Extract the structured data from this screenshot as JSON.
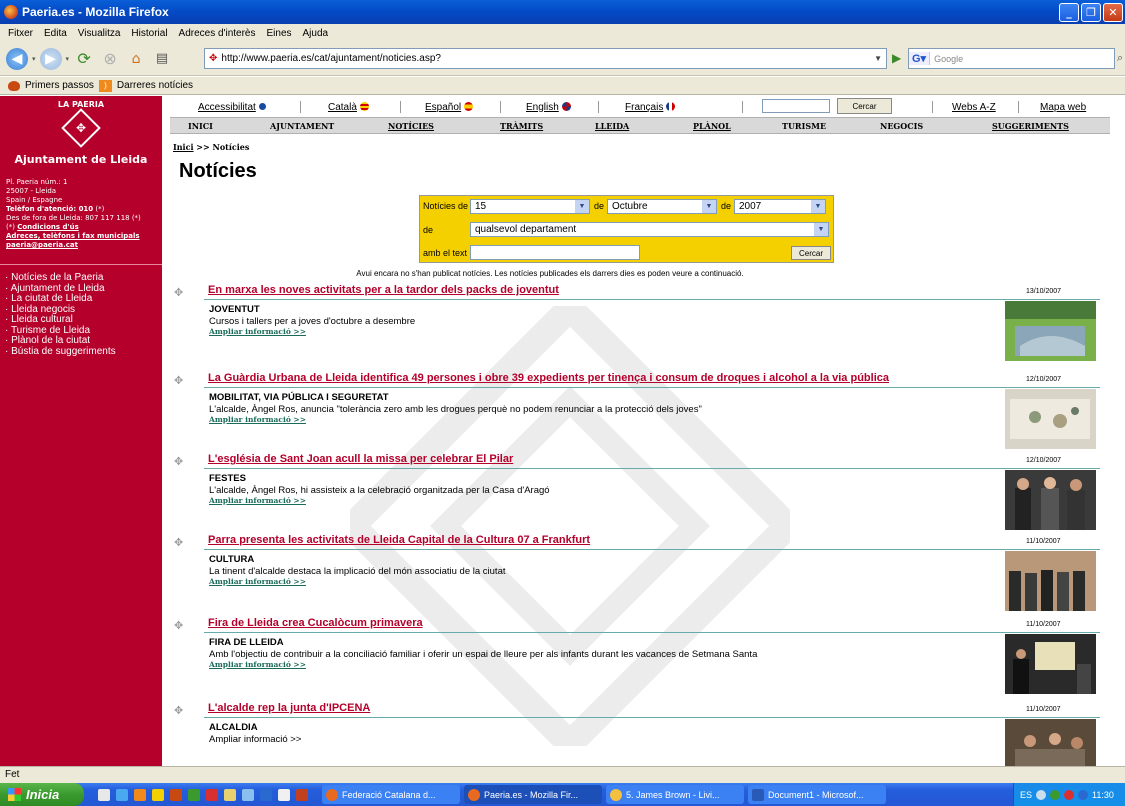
{
  "window": {
    "title": "Paeria.es - Mozilla Firefox"
  },
  "menubar": [
    "Fitxer",
    "Edita",
    "Visualitza",
    "Historial",
    "Adreces d'interès",
    "Eines",
    "Ajuda"
  ],
  "nav": {
    "url": "http://www.paeria.es/cat/ajuntament/noticies.asp?",
    "search_placeholder": "Google"
  },
  "bookmarks": [
    "Primers passos",
    "Darreres notícies"
  ],
  "sidebar": {
    "brand": "LA PAERIA",
    "org": "Ajuntament de Lleida",
    "address": [
      "Pl. Paeria núm.: 1",
      "25007 - Lleida",
      "Spain / Espagne"
    ],
    "phone_label": "Telèfon d'atenció: 010",
    "phone_suffix": "(*)",
    "outside_phone": "Des de fora de Lleida: 807 117 118 (*)",
    "conditions_prefix": "(*) ",
    "conditions_link": "Condicions d'ús",
    "addresses_link": "Adreces, telèfons i fax municipals",
    "email": "paeria@paeria.cat",
    "menu": [
      "Notícies de la Paeria",
      "Ajuntament de Lleida",
      "La ciutat de Lleida",
      "Lleida negocis",
      "Lleida cultural",
      "Turisme de Lleida",
      "Plànol de la ciutat",
      "Bústia de suggeriments"
    ]
  },
  "langbar": {
    "accessibility": "Accessibilitat",
    "languages": [
      "Català",
      "Español",
      "English",
      "Français"
    ],
    "search_button": "Cercar",
    "webs": "Webs A-Z",
    "sitemap": "Mapa web"
  },
  "mainnav": [
    "INICI",
    "AJUNTAMENT",
    "NOTÍCIES",
    "TRÀMITS",
    "LLEIDA",
    "PLÀNOL",
    "TURISME",
    "NEGOCIS",
    "SUGGERIMENTS"
  ],
  "breadcrumb": {
    "home": "Inici",
    "sep": " >> ",
    "current": "Notícies"
  },
  "page_title": "Notícies",
  "filter": {
    "label_news": "Notícies de",
    "day": "15",
    "label_de1": "de",
    "month": "Octubre",
    "label_de2": "de",
    "year": "2007",
    "label_de3": "de",
    "department": "qualsevol departament",
    "label_text": "amb el text",
    "text_value": "",
    "button": "Cercar"
  },
  "notice": "Avui encara no s'han publicat notícies. Les notícies publicades els darrers dies es poden veure a continuació.",
  "more_label": "Ampliar informació >>",
  "news": [
    {
      "title": "En marxa les noves activitats per a la tardor dels packs de joventut",
      "date": "13/10/2007",
      "category": "JOVENTUT",
      "summary": "Cursos i tallers per a joves d'octubre a desembre"
    },
    {
      "title": "La Guàrdia Urbana de Lleida identifica 49 persones i obre 39 expedients per tinença i consum de droques i alcohol a la via pública",
      "date": "12/10/2007",
      "category": "MOBILITAT, VIA PÚBLICA I SEGURETAT",
      "summary": "L'alcalde, Àngel Ros, anuncia \"tolerància zero amb les drogues perquè no podem renunciar a la protecció dels joves\""
    },
    {
      "title": "L'església de Sant Joan acull la missa per celebrar El Pilar",
      "date": "12/10/2007",
      "category": "FESTES",
      "summary": "L'alcalde, Àngel Ros, hi assisteix a la celebració organitzada per la Casa d'Aragó"
    },
    {
      "title": "Parra presenta les activitats de Lleida Capital de la Cultura 07 a Frankfurt",
      "date": "11/10/2007",
      "category": "CULTURA",
      "summary": "La tinent d'alcalde destaca la implicació del món associatiu de la ciutat"
    },
    {
      "title": "Fira de Lleida crea Cucalòcum primavera",
      "date": "11/10/2007",
      "category": "FIRA DE LLEIDA",
      "summary": "Amb l'objectiu de contribuir a la conciliació familiar i oferir un espai de lleure per als infants durant les vacances de Setmana Santa"
    },
    {
      "title": "L'alcalde rep la junta d'IPCENA",
      "date": "11/10/2007",
      "category": "ALCALDIA",
      "summary": ""
    }
  ],
  "status": "Fet",
  "taskbar": {
    "start": "Inicia",
    "tasks": [
      "Federació Catalana d...",
      "Paeria.es - Mozilla Fir...",
      "5. James Brown - Livi...",
      "Document1 - Microsof..."
    ],
    "lang": "ES",
    "clock": "11:30"
  },
  "colors": {
    "brand_red": "#b4002a",
    "filter_yellow": "#f5d000",
    "link_green": "#1a6b5a"
  }
}
